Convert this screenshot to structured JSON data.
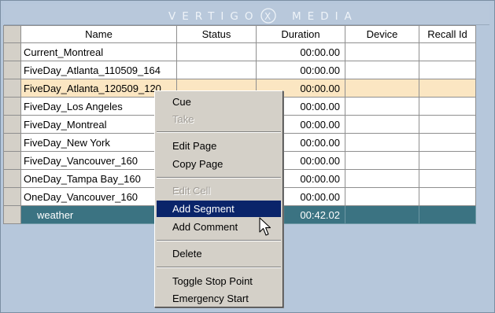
{
  "app": {
    "brand": "VERTIGO Ⓧ MEDIA"
  },
  "logo": {
    "left": "VERTIGO",
    "mark": "X",
    "right": "MEDIA"
  },
  "table": {
    "columns": [
      "Name",
      "Status",
      "Duration",
      "Device",
      "Recall Id"
    ],
    "rows": [
      {
        "name": "Current_Montreal",
        "status": "",
        "duration": "00:00.00",
        "device": "",
        "recall_id": ""
      },
      {
        "name": "FiveDay_Atlanta_110509_164",
        "status": "",
        "duration": "00:00.00",
        "device": "",
        "recall_id": ""
      },
      {
        "name": "FiveDay_Atlanta_120509_120",
        "status": "",
        "duration": "00:00.00",
        "device": "",
        "recall_id": ""
      },
      {
        "name": "FiveDay_Los Angeles",
        "status": "",
        "duration": "00:00.00",
        "device": "",
        "recall_id": ""
      },
      {
        "name": "FiveDay_Montreal",
        "status": "",
        "duration": "00:00.00",
        "device": "",
        "recall_id": ""
      },
      {
        "name": "FiveDay_New York",
        "status": "",
        "duration": "00:00.00",
        "device": "",
        "recall_id": ""
      },
      {
        "name": "FiveDay_Vancouver_160",
        "status": "",
        "duration": "00:00.00",
        "device": "",
        "recall_id": ""
      },
      {
        "name": "OneDay_Tampa Bay_160",
        "status": "",
        "duration": "00:00.00",
        "device": "",
        "recall_id": ""
      },
      {
        "name": "OneDay_Vancouver_160",
        "status": "",
        "duration": "00:00.00",
        "device": "",
        "recall_id": ""
      },
      {
        "name": "weather",
        "status": "",
        "duration": "00:42.02",
        "device": "",
        "recall_id": ""
      }
    ]
  },
  "context_menu": {
    "items": [
      {
        "label": "Cue",
        "disabled": false
      },
      {
        "label": "Take",
        "disabled": true
      },
      {
        "label": "Edit Page",
        "disabled": false
      },
      {
        "label": "Copy Page",
        "disabled": false
      },
      {
        "label": "Edit Cell",
        "disabled": true
      },
      {
        "label": "Add Segment",
        "disabled": false,
        "highlighted": true
      },
      {
        "label": "Add Comment",
        "disabled": false
      },
      {
        "label": "Delete",
        "disabled": false
      },
      {
        "label": "Toggle Stop Point",
        "disabled": false
      },
      {
        "label": "Emergency Start",
        "disabled": false
      }
    ]
  },
  "colors": {
    "background": "#b4c6da",
    "selected_row": "#fbe6c2",
    "group_row": "#3b7382",
    "menu_highlight": "#0a246a"
  },
  "icons": {
    "cursor": "arrow-pointer-icon",
    "logo_mark": "circled-x-icon"
  }
}
